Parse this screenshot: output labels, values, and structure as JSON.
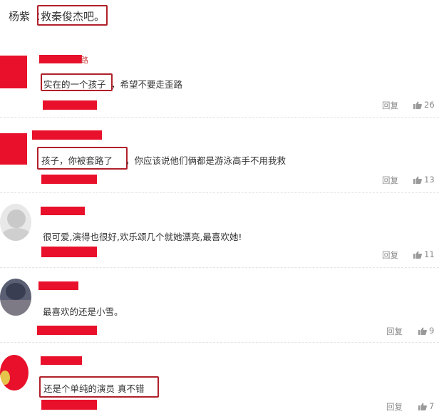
{
  "header": {
    "username": "杨紫",
    "colon": "：",
    "comment": "救秦俊杰吧。"
  },
  "comments": [
    {
      "text_highlight": "实在的一个孩子",
      "text_rest": "，希望不要走歪路",
      "reply": "回复",
      "likes": "26"
    },
    {
      "text_highlight": "孩子，你被套路了",
      "text_rest": "，你应该说他们俩都是游泳高手不用我救",
      "reply": "回复",
      "likes": "13"
    },
    {
      "text": "很可爱,演得也很好,欢乐颂几个就她漂亮,最喜欢她!",
      "reply": "回复",
      "likes": "11"
    },
    {
      "text": "最喜欢的还是小雪。",
      "reply": "回复",
      "likes": "9"
    },
    {
      "text": "还是个单纯的演员 真不错",
      "reply": "回复",
      "likes": "7"
    }
  ],
  "colors": {
    "redaction": "#e8102a",
    "highlight_border": "#b0202a",
    "meta_text": "#8a8a8a"
  }
}
